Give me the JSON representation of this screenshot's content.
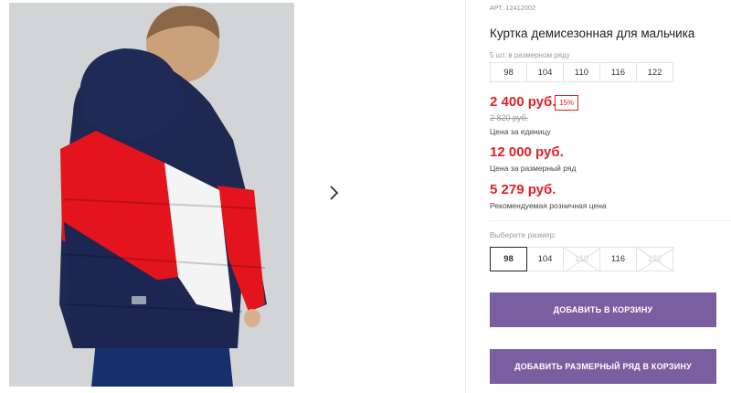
{
  "product": {
    "article": "АРТ. 12412002",
    "title": "Куртка демисезонная для мальчика"
  },
  "size_row": {
    "label": "5 шт. в размерном ряду",
    "sizes": [
      "98",
      "104",
      "110",
      "116",
      "122"
    ]
  },
  "prices": {
    "unit_price": "2 400 руб.",
    "discount": "15%",
    "old_price": "2 820 руб.",
    "unit_caption": "Цена за единицу",
    "row_price": "12 000 руб.",
    "row_caption": "Цена за размерный ряд",
    "retail_price": "5 279 руб.",
    "retail_caption": "Рекомендуемая розничная цена"
  },
  "size_picker": {
    "label": "Выберите размер:",
    "options": [
      {
        "label": "98",
        "state": "selected"
      },
      {
        "label": "104",
        "state": "available"
      },
      {
        "label": "110",
        "state": "unavailable"
      },
      {
        "label": "116",
        "state": "available"
      },
      {
        "label": "122",
        "state": "unavailable"
      }
    ]
  },
  "buttons": {
    "add_to_cart": "ДОБАВИТЬ В КОРЗИНУ",
    "add_row_to_cart": "ДОБАВИТЬ РАЗМЕРНЫЙ РЯД В КОРЗИНУ"
  },
  "gallery": {
    "next_icon": "chevron-right-icon"
  },
  "colors": {
    "accent_price": "#e31e24",
    "button_purple": "#7a5fa0",
    "jacket_navy": "#1e2850",
    "jacket_red": "#e3141e"
  }
}
